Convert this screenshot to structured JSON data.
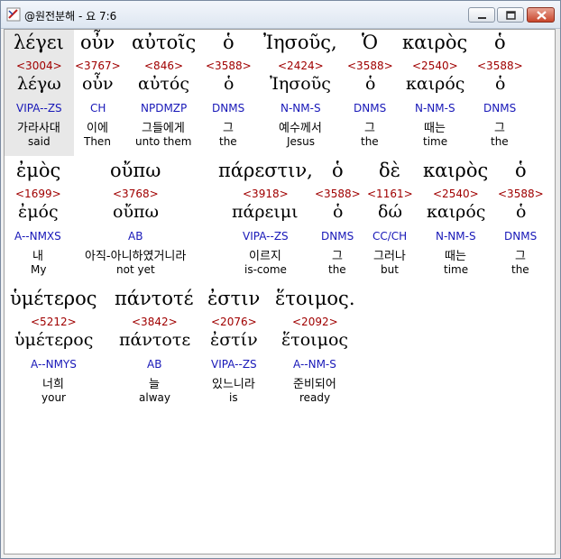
{
  "window": {
    "title": "@원전분해 - 요 7:6"
  },
  "rows": [
    [
      {
        "greek": "λέγει",
        "strong": "<3004>",
        "lemma": "λέγω",
        "parse": "VIPA--ZS",
        "korean": "가라사대",
        "english": "said"
      },
      {
        "greek": "οὖν",
        "strong": "<3767>",
        "lemma": "οὖν",
        "parse": "CH",
        "korean": "이에",
        "english": "Then"
      },
      {
        "greek": "αὐτοῖς",
        "strong": "<846>",
        "lemma": "αὐτός",
        "parse": "NPDMZP",
        "korean": "그들에게",
        "english": "unto them"
      },
      {
        "greek": "ὁ",
        "strong": "<3588>",
        "lemma": "ὁ",
        "parse": "DNMS",
        "korean": "그",
        "english": "the"
      },
      {
        "greek": "Ἰησοῦς,",
        "strong": "<2424>",
        "lemma": "Ἰησοῦς",
        "parse": "N-NM-S",
        "korean": "예수께서",
        "english": "Jesus"
      },
      {
        "greek": "Ὁ",
        "strong": "<3588>",
        "lemma": "ὁ",
        "parse": "DNMS",
        "korean": "그",
        "english": "the"
      },
      {
        "greek": "καιρὸς",
        "strong": "<2540>",
        "lemma": "καιρός",
        "parse": "N-NM-S",
        "korean": "때는",
        "english": "time"
      },
      {
        "greek": "ὁ",
        "strong": "<3588>",
        "lemma": "ὁ",
        "parse": "DNMS",
        "korean": "그",
        "english": "the"
      }
    ],
    [
      {
        "greek": "ἐμὸς",
        "strong": "<1699>",
        "lemma": "ἐμός",
        "parse": "A--NMXS",
        "korean": "내",
        "english": "My"
      },
      {
        "greek": "οὔπω",
        "strong": "<3768>",
        "lemma": "οὔπω",
        "parse": "AB",
        "korean": "아직-아니하였거니라",
        "english": "not yet"
      },
      {
        "greek": "πάρεστιν,",
        "strong": "<3918>",
        "lemma": "πάρειμι",
        "parse": "VIPA--ZS",
        "korean": "이르지",
        "english": "is-come"
      },
      {
        "greek": "ὁ",
        "strong": "<3588>",
        "lemma": "ὁ",
        "parse": "DNMS",
        "korean": "그",
        "english": "the"
      },
      {
        "greek": "δὲ",
        "strong": "<1161>",
        "lemma": "δώ",
        "parse": "CC/CH",
        "korean": "그러나",
        "english": "but"
      },
      {
        "greek": "καιρὸς",
        "strong": "<2540>",
        "lemma": "καιρός",
        "parse": "N-NM-S",
        "korean": "때는",
        "english": "time"
      },
      {
        "greek": "ὁ",
        "strong": "<3588>",
        "lemma": "ὁ",
        "parse": "DNMS",
        "korean": "그",
        "english": "the"
      }
    ],
    [
      {
        "greek": "ὑμέτερος",
        "strong": "<5212>",
        "lemma": "ὑμέτερος",
        "parse": "A--NMYS",
        "korean": "너희",
        "english": "your"
      },
      {
        "greek": "πάντοτέ",
        "strong": "<3842>",
        "lemma": "πάντοτε",
        "parse": "AB",
        "korean": "늘",
        "english": "alway"
      },
      {
        "greek": "ἐστιν",
        "strong": "<2076>",
        "lemma": "ἐστίν",
        "parse": "VIPA--ZS",
        "korean": "있느니라",
        "english": "is"
      },
      {
        "greek": "ἕτοιμος.",
        "strong": "<2092>",
        "lemma": "ἕτοιμος",
        "parse": "A--NM-S",
        "korean": "준비되어",
        "english": "ready"
      }
    ]
  ]
}
